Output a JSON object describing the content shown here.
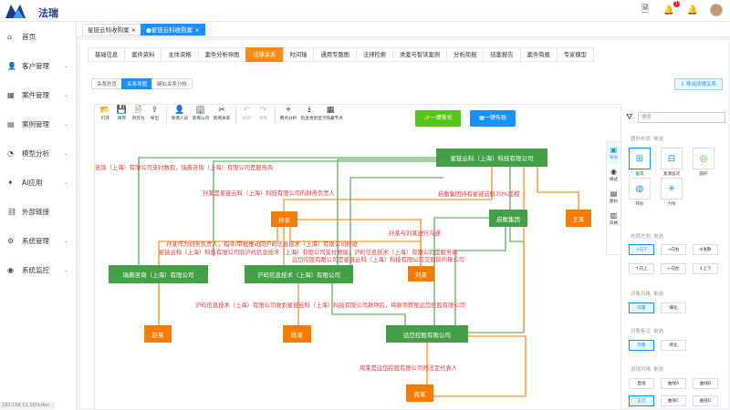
{
  "app": {
    "logo_text": "法瑞",
    "ip": "192.168.11.16/index"
  },
  "header": {
    "notifications": "1",
    "msg_badge": ""
  },
  "sidebar": {
    "items": [
      {
        "label": "首页",
        "icon": "home-icon",
        "arrow": false
      },
      {
        "label": "客户管理",
        "icon": "user-icon",
        "arrow": true
      },
      {
        "label": "案件管理",
        "icon": "case-icon",
        "arrow": true
      },
      {
        "label": "案例管理",
        "icon": "book-icon",
        "arrow": true
      },
      {
        "label": "模型分析",
        "icon": "chart-icon",
        "arrow": true
      },
      {
        "label": "AI应用",
        "icon": "ai-icon",
        "arrow": true
      },
      {
        "label": "外部链接",
        "icon": "link-icon",
        "arrow": false
      },
      {
        "label": "系统管理",
        "icon": "gear-icon",
        "arrow": true
      },
      {
        "label": "系统监控",
        "icon": "monitor-icon",
        "arrow": true
      }
    ]
  },
  "open_tabs": [
    {
      "label": "星链云科收购案",
      "close": "×"
    },
    {
      "label": "●星链云科收购案",
      "close": "×"
    }
  ],
  "nav_tabs": [
    "基础信息",
    "案件资料",
    "主体资格",
    "案件分析导图",
    "法律关系",
    "时间轴",
    "通用专题图",
    "法律检索",
    "类案与智读案例",
    "分析简报",
    "结案报告",
    "案件简报",
    "专家模型"
  ],
  "sub_tabs": [
    "关系总览",
    "关系导图",
    "疑似关系分析"
  ],
  "export_label": "导出法律关系",
  "toolbar": [
    {
      "icon": "📂",
      "label": "打开",
      "dis": false
    },
    {
      "icon": "💾",
      "label": "保存",
      "dis": false
    },
    {
      "icon": "🗎",
      "label": "另存为",
      "dis": false
    },
    {
      "icon": "⇪",
      "label": "导出",
      "dis": false
    },
    {
      "icon": "👤",
      "label": "新增人员",
      "dis": false
    },
    {
      "icon": "🏢",
      "label": "新增公司",
      "dis": false
    },
    {
      "icon": "✂",
      "label": "新增关系",
      "dis": false
    },
    {
      "icon": "↶",
      "label": "撤销",
      "dis": true
    },
    {
      "icon": "↷",
      "label": "重做",
      "dis": true
    },
    {
      "icon": "⌖",
      "label": "两点分析",
      "dis": false
    },
    {
      "icon": "⭳",
      "label": "检查更新",
      "dis": false
    },
    {
      "icon": "▦",
      "label": "显示隐藏节点",
      "dis": false
    }
  ],
  "actions": {
    "beautify": "一键美化",
    "layout": "一键布局"
  },
  "search_placeholder": "搜索",
  "rail": [
    {
      "icon": "▣",
      "label": "布局"
    },
    {
      "icon": "◉",
      "label": "样式"
    },
    {
      "icon": "▤",
      "label": "图标"
    },
    {
      "icon": "▥",
      "label": "风格"
    }
  ],
  "panel": {
    "layout_title": "圆形布局",
    "single": "单选",
    "layouts": [
      "层次",
      "紧凑层次",
      "圆形",
      "环形",
      "力导"
    ],
    "dir_title": "布局方向",
    "dirs": [
      "向下",
      "向右",
      "发散",
      "向上",
      "向左",
      "上下"
    ],
    "style_title": "对象风格",
    "styles": [
      "同置",
      "细化"
    ],
    "label_title": "对象标注",
    "labels": [
      "完整",
      "简化"
    ],
    "line_title": "连线风格",
    "lines": [
      "直线",
      "曲线A",
      "曲线B",
      "正交",
      "曲线C",
      "曲线D"
    ]
  },
  "graph": {
    "nodes": [
      {
        "id": "xl",
        "label": "星链云科（上海）科技有限公司",
        "type": "company"
      },
      {
        "id": "sun",
        "label": "孙某",
        "type": "person"
      },
      {
        "id": "qh",
        "label": "启衡集团",
        "type": "company"
      },
      {
        "id": "wang",
        "label": "王某",
        "type": "person"
      },
      {
        "id": "rd",
        "label": "瑞典咨询（上海）有限公司",
        "type": "company"
      },
      {
        "id": "hy",
        "label": "沪屿信息技术（上海）有限公司",
        "type": "company"
      },
      {
        "id": "liu",
        "label": "刘某",
        "type": "person"
      },
      {
        "id": "zhao",
        "label": "赵某",
        "type": "person"
      },
      {
        "id": "chen",
        "label": "陈某",
        "type": "person"
      },
      {
        "id": "yc",
        "label": "远岱控股有限公司",
        "type": "company"
      },
      {
        "id": "zhou",
        "label": "周某",
        "type": "person"
      }
    ],
    "edge_labels": [
      "咨询（上海）有限公司支付数现，瑞典咨询（上海）有限公司是服务商",
      "孙某是星链云科（上海）科技有限公司的财务负责人",
      "启衡集团持有星链云科70%股权",
      "孙某与刘某进行沟通",
      "孙某作为财务负责人，指令/审批推动向沪屿信息技术（上海）有限公司付款",
      "星链云科（上海）科技有限公司向沪屿信息技术（上海）有限公司支付数现，沪屿信息技术（上海）有限公司是服务商",
      "远岱控股有限公司是星链云科（上海）科技有限公司交割前的母公司",
      "沪屿信息技术（上海）有限公司收到星链云科（上海）科技有限公司款项后，将款项转至远岱控股有限公司",
      "周某是远岱控股有限公司的法定代表人"
    ]
  }
}
